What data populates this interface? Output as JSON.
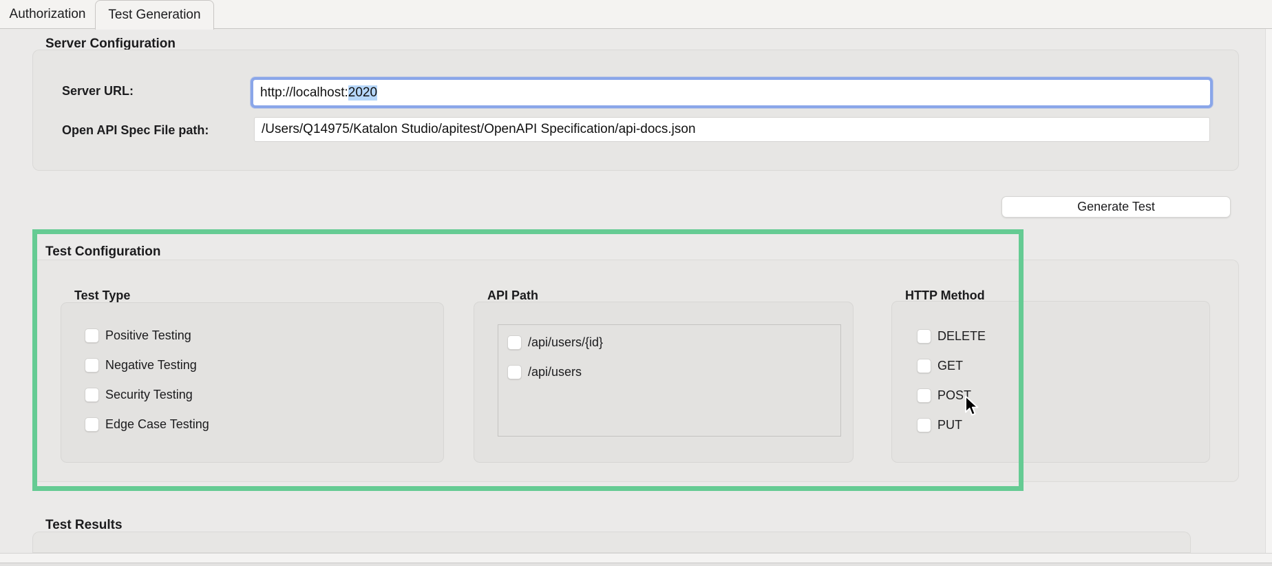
{
  "tabs": {
    "authorization": "Authorization",
    "test_generation": "Test Generation"
  },
  "server_configuration": {
    "title": "Server Configuration",
    "server_url_label": "Server URL:",
    "server_url_value": "http://localhost:",
    "server_url_selected_text": "2020",
    "spec_path_label": "Open API Spec File path:",
    "spec_path_value": "/Users/Q14975/Katalon Studio/apitest/OpenAPI Specification/api-docs.json"
  },
  "actions": {
    "generate_test": "Generate Test"
  },
  "test_configuration": {
    "title": "Test Configuration",
    "test_type": {
      "title": "Test Type",
      "options": [
        {
          "label": "Positive Testing",
          "checked": false
        },
        {
          "label": "Negative Testing",
          "checked": false
        },
        {
          "label": "Security Testing",
          "checked": false
        },
        {
          "label": "Edge Case Testing",
          "checked": false
        }
      ]
    },
    "api_path": {
      "title": "API Path",
      "options": [
        {
          "label": "/api/users/{id}",
          "checked": false
        },
        {
          "label": "/api/users",
          "checked": false
        }
      ]
    },
    "http_method": {
      "title": "HTTP Method",
      "options": [
        {
          "label": "DELETE",
          "checked": false
        },
        {
          "label": "GET",
          "checked": false
        },
        {
          "label": "POST",
          "checked": false
        },
        {
          "label": "PUT",
          "checked": false
        }
      ]
    }
  },
  "test_results": {
    "title": "Test Results"
  },
  "colors": {
    "annotation_green": "#65cb93",
    "focus_ring_blue": "#8aa6e9",
    "text_selection_blue": "#b6d7fa",
    "window_background": "#ebeae9",
    "panel_background": "#e7e6e4"
  }
}
